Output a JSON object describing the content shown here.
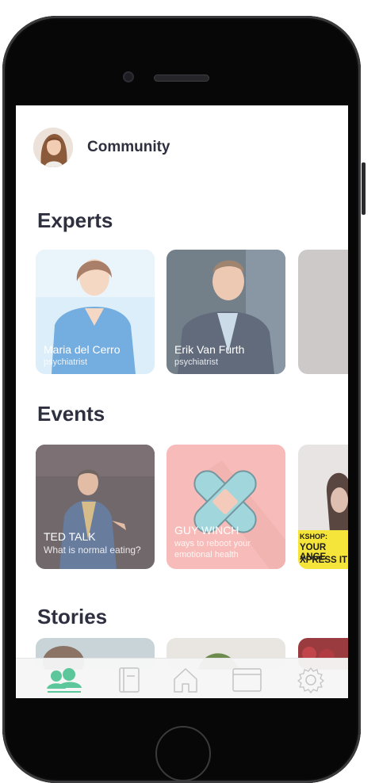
{
  "header": {
    "title": "Community",
    "avatar": "user-avatar"
  },
  "sections": {
    "experts": {
      "title": "Experts",
      "cards": [
        {
          "name": "Maria del Cerro",
          "role": "psychiatrist"
        },
        {
          "name": "Erik Van Furth",
          "role": "psychiatrist"
        }
      ]
    },
    "events": {
      "title": "Events",
      "cards": [
        {
          "title": "TED TALK",
          "subtitle": "What is normal eating?"
        },
        {
          "title": "GUY WINCH",
          "subtitle": "ways to reboot your emotional health"
        },
        {
          "line1": "KSHOP:",
          "line2": "YOUR ANGE",
          "line3": "XPRESS IT"
        }
      ]
    },
    "stories": {
      "title": "Stories"
    }
  },
  "tabbar": {
    "items": [
      {
        "icon": "community-icon",
        "active": true
      },
      {
        "icon": "journal-icon",
        "active": false
      },
      {
        "icon": "home-icon",
        "active": false
      },
      {
        "icon": "calendar-icon",
        "active": false
      },
      {
        "icon": "settings-icon",
        "active": false
      }
    ]
  },
  "colors": {
    "accent": "#5cc79a",
    "title_text": "#2e3040",
    "inactive_icon": "#c4c4c4",
    "events_card_pink": "#f4a39f",
    "workshop_yellow": "#f5e43a"
  }
}
